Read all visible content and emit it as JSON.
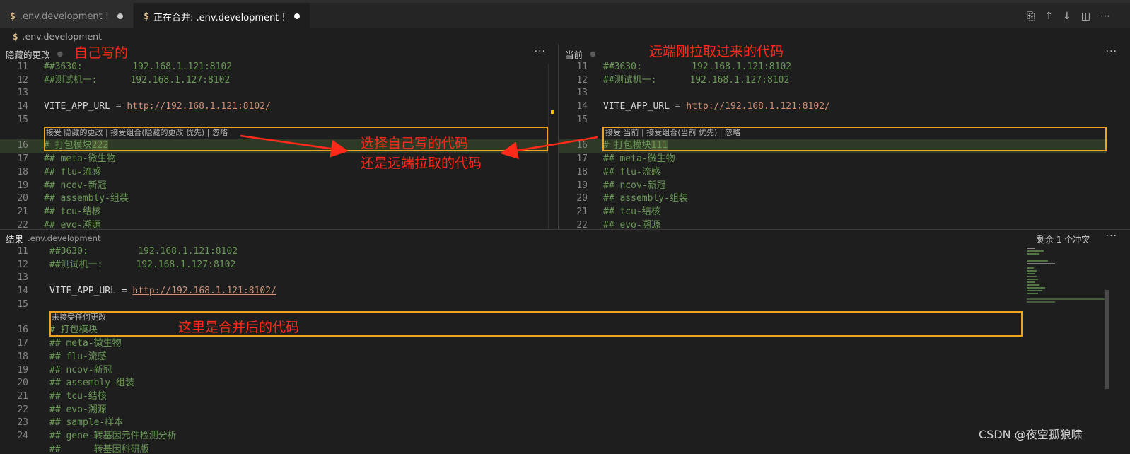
{
  "tabs": [
    {
      "icon": "$",
      "label": ".env.development !",
      "active": false
    },
    {
      "icon": "$",
      "label": "正在合并: .env.development !",
      "active": true
    }
  ],
  "breadcrumb": {
    "icon": "$",
    "label": ".env.development"
  },
  "left_pane": {
    "title": "隐藏的更改",
    "annotation": "自己写的"
  },
  "right_pane": {
    "title": "当前",
    "annotation": "远端刚拉取过来的代码"
  },
  "middle_annotation": {
    "line1": "选择自己写的代码",
    "line2": "还是远端拉取的代码"
  },
  "left_codelens": "接受 隐藏的更改 | 接受组合(隐藏的更改 优先) | 忽略",
  "right_codelens": "接受 当前 | 接受组合(当前 优先) | 忽略",
  "result_pane": {
    "title": "结果",
    "filename": ".env.development",
    "remaining": "剩余 1 个冲突",
    "codelens": "未接受任何更改",
    "annotation": "这里是合并后的代码"
  },
  "top_lines": [
    {
      "num": "11",
      "text": "##3630:         192.168.1.121:8102"
    },
    {
      "num": "12",
      "text": "##测试机一:      192.168.1.127:8102"
    },
    {
      "num": "13",
      "text": ""
    },
    {
      "num": "14",
      "prefix": "VITE_APP_URL = ",
      "url": "http://192.168.1.121:8102/"
    },
    {
      "num": "15",
      "text": ""
    }
  ],
  "left_line16": {
    "num": "16",
    "base": "# 打包模块",
    "added": "222"
  },
  "right_line16": {
    "num": "16",
    "base": "# 打包模块",
    "added": "111"
  },
  "after_lines": [
    {
      "num": "17",
      "text": "## meta-微生物"
    },
    {
      "num": "18",
      "text": "## flu-流感"
    },
    {
      "num": "19",
      "text": "## ncov-新冠"
    },
    {
      "num": "20",
      "text": "## assembly-组装"
    },
    {
      "num": "21",
      "text": "## tcu-结核"
    },
    {
      "num": "22",
      "text": "## evo-溯源"
    }
  ],
  "result_line16": {
    "num": "16",
    "text": "# 打包模块"
  },
  "result_after_lines": [
    {
      "num": "17",
      "text": "## meta-微生物"
    },
    {
      "num": "18",
      "text": "## flu-流感"
    },
    {
      "num": "19",
      "text": "## ncov-新冠"
    },
    {
      "num": "20",
      "text": "## assembly-组装"
    },
    {
      "num": "21",
      "text": "## tcu-结核"
    },
    {
      "num": "22",
      "text": "## evo-溯源"
    },
    {
      "num": "23",
      "text": "## sample-样本"
    },
    {
      "num": "24",
      "text": "## gene-转基因元件检测分析"
    },
    {
      "num": "",
      "text": "##      转基因科研版"
    }
  ],
  "watermark": "CSDN @夜空孤狼啸",
  "colors": {
    "conflict_border": "#f0a31f",
    "annotation": "#ff2a1a",
    "comment": "#6a9955",
    "url": "#ce9178"
  }
}
